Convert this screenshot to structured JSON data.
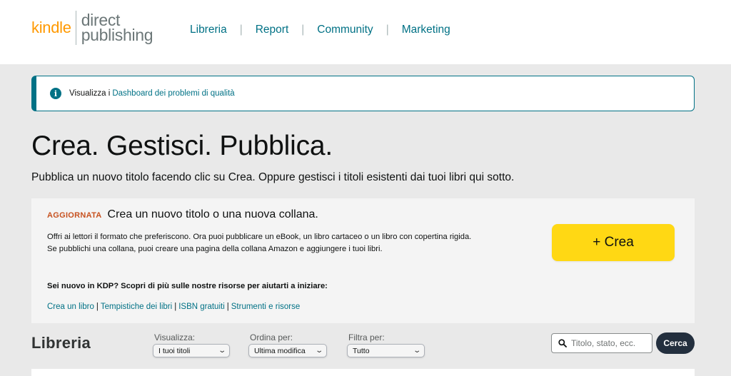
{
  "header": {
    "logo": {
      "kindle": "kindle",
      "direct": "direct",
      "publishing": "publishing"
    },
    "nav": [
      "Libreria",
      "Report",
      "Community",
      "Marketing"
    ],
    "separator": "|"
  },
  "alert": {
    "icon": "info-icon",
    "prefix": "Visualizza i",
    "link": "Dashboard dei problemi di qualità"
  },
  "page": {
    "title": "Crea. Gestisci. Pubblica.",
    "subtitle": "Pubblica un nuovo titolo facendo clic su Crea. Oppure gestisci i titoli esistenti dai tuoi libri qui sotto."
  },
  "create_panel": {
    "badge": "AGGIORNATA",
    "title": "Crea un nuovo titolo o una nuova collana.",
    "description": "Offri ai lettori il formato che preferiscono. Ora puoi pubblicare un eBook, un libro cartaceo o un libro con copertina rigida. Se pubblichi una collana, puoi creare una pagina della collana Amazon e aggiungere i tuoi libri.",
    "new_question": "Sei nuovo in KDP? Scopri di più sulle nostre risorse per aiutarti a iniziare:",
    "links": [
      "Crea un libro",
      "Tempistiche dei libri",
      "ISBN gratuiti",
      "Strumenti e risorse"
    ],
    "link_separator": "|",
    "create_button": "+ Crea",
    "accent_color": "#ffd814"
  },
  "library": {
    "title": "Libreria",
    "filters": [
      {
        "label": "Visualizza:",
        "value": "I tuoi titoli"
      },
      {
        "label": "Ordina per:",
        "value": "Ultima modifica"
      },
      {
        "label": "Filtra per:",
        "value": "Tutto"
      }
    ],
    "search": {
      "placeholder": "Titolo, stato, ecc.",
      "value": "",
      "button": "Cerca"
    }
  },
  "colors": {
    "link": "#007185",
    "badge": "#c7511f",
    "logo_orange": "#ff9900",
    "search_button": "#232f3e"
  }
}
